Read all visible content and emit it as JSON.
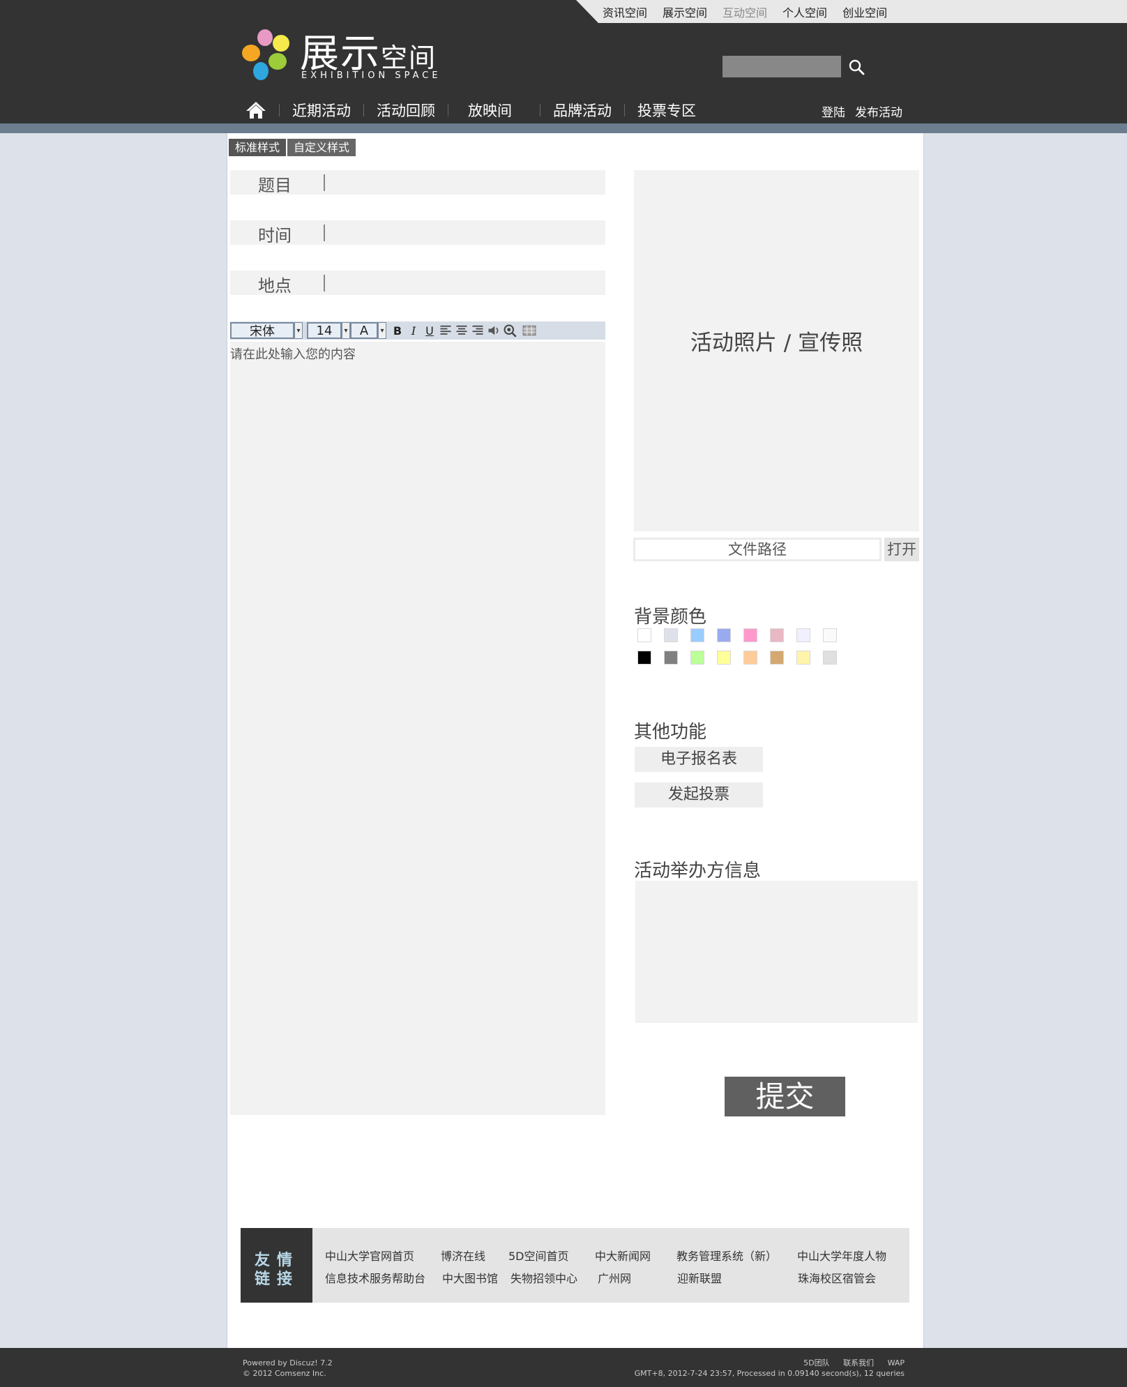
{
  "top_nav": [
    {
      "label": "资讯空间",
      "dim": false
    },
    {
      "label": "展示空间",
      "dim": false
    },
    {
      "label": "互动空间",
      "dim": true
    },
    {
      "label": "个人空间",
      "dim": false
    },
    {
      "label": "创业空间",
      "dim": false
    }
  ],
  "logo": {
    "title_big": "展示",
    "title_small": "空间",
    "subtitle": "EXHIBITION SPACE"
  },
  "search": {
    "placeholder": ""
  },
  "main_nav": [
    "近期活动",
    "活动回顾",
    "放映间",
    "品牌活动",
    "投票专区"
  ],
  "user_links": {
    "login": "登陆",
    "publish": "发布活动"
  },
  "style_tabs": [
    "标准样式",
    "自定义样式"
  ],
  "form": {
    "title_label": "题目",
    "time_label": "时间",
    "place_label": "地点"
  },
  "toolbar": {
    "font": "宋体",
    "size": "14",
    "color_letter": "A",
    "bold": "B",
    "italic": "I",
    "underline": "U"
  },
  "editor": {
    "placeholder": "请在此处输入您的内容"
  },
  "photo": {
    "caption": "活动照片 / 宣传照",
    "file_path": "文件路径",
    "open": "打开"
  },
  "background": {
    "title": "背景颜色",
    "colors": [
      "#ffffff",
      "#dde2ea",
      "#99ccff",
      "#99aaee",
      "#ff99cc",
      "#e8b8c4",
      "#f0f0ff",
      "#fafafa",
      "#000000",
      "#808080",
      "#bbff99",
      "#ffff99",
      "#ffcc99",
      "#d4a870",
      "#fff5aa",
      "#e0e0e0"
    ]
  },
  "other": {
    "title": "其他功能",
    "signup": "电子报名表",
    "vote": "发起投票"
  },
  "organizer": {
    "title": "活动举办方信息"
  },
  "submit": "提交",
  "friend_links": {
    "label_line1": "友情",
    "label_line2": "链接",
    "row1": [
      "中山大学官网首页",
      "博济在线",
      "5D空间首页",
      "中大新闻网",
      "教务管理系统（新）",
      "中山大学年度人物"
    ],
    "row2": [
      "信息技术服务帮助台",
      "中大图书馆",
      "失物招领中心",
      "广州网",
      "迎新联盟",
      "珠海校区宿管会"
    ]
  },
  "footer": {
    "powered": "Powered by Discuz! 7.2",
    "copyright": "© 2012 Comsenz Inc.",
    "links": [
      "5D团队",
      "联系我们",
      "WAP"
    ],
    "stats": "GMT+8, 2012-7-24 23:57,  Processed in 0.09140 second(s), 12 queries"
  }
}
